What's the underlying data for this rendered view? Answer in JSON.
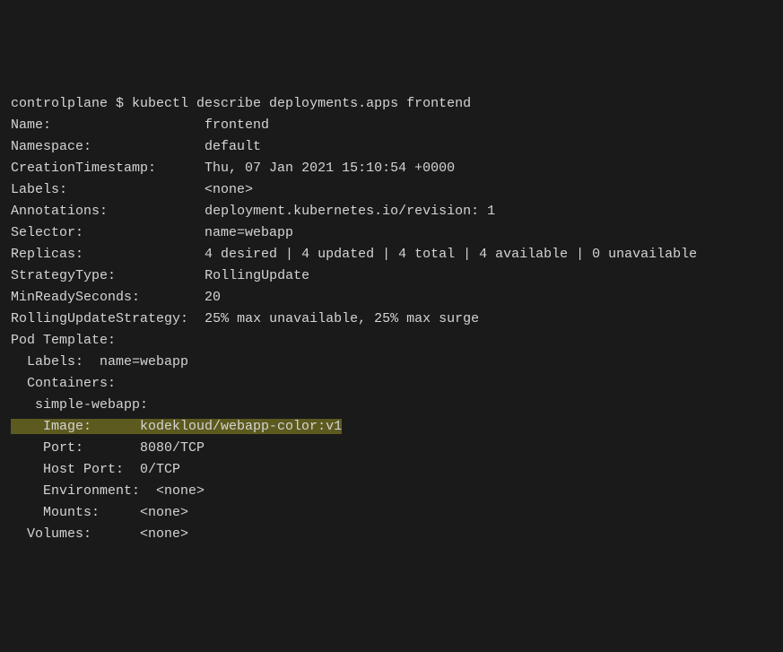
{
  "prompt": "controlplane $ ",
  "command": "kubectl describe deployments.apps frontend",
  "fields": {
    "name_label": "Name:",
    "name_value": "frontend",
    "namespace_label": "Namespace:",
    "namespace_value": "default",
    "creation_label": "CreationTimestamp:",
    "creation_value": "Thu, 07 Jan 2021 15:10:54 +0000",
    "labels_label": "Labels:",
    "labels_value": "<none>",
    "annotations_label": "Annotations:",
    "annotations_value": "deployment.kubernetes.io/revision: 1",
    "selector_label": "Selector:",
    "selector_value": "name=webapp",
    "replicas_label": "Replicas:",
    "replicas_value": "4 desired | 4 updated | 4 total | 4 available | 0 unavailable",
    "strategy_label": "StrategyType:",
    "strategy_value": "RollingUpdate",
    "minready_label": "MinReadySeconds:",
    "minready_value": "20",
    "rollingupdate_label": "RollingUpdateStrategy:",
    "rollingupdate_value": "25% max unavailable, 25% max surge",
    "podtemplate_label": "Pod Template:",
    "podlabels_label": "  Labels:  ",
    "podlabels_value": "name=webapp",
    "containers_label": "  Containers:",
    "container_name": "   simple-webapp:",
    "image_label": "    Image:      ",
    "image_value": "kodekloud/webapp-color:v1",
    "port_label": "    Port:       ",
    "port_value": "8080/TCP",
    "hostport_label": "    Host Port:  ",
    "hostport_value": "0/TCP",
    "env_label": "    Environment:",
    "env_value": "<none>",
    "mounts_label": "    Mounts:     ",
    "mounts_value": "<none>",
    "volumes_label": "  Volumes:      ",
    "volumes_value": "<none>"
  }
}
